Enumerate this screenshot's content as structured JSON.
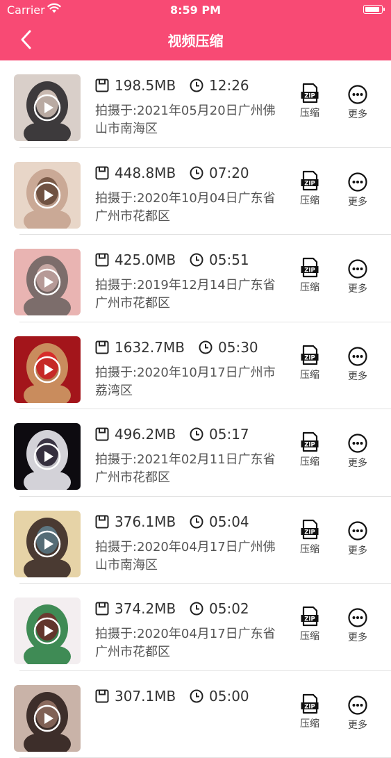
{
  "status_bar": {
    "carrier": "Carrier",
    "time": "8:59 PM",
    "battery_level": 1.0
  },
  "header": {
    "title": "视频压缩",
    "back_icon": "chevron-left-icon"
  },
  "colors": {
    "brand": "#f84a74",
    "separator": "#e2e2e2",
    "text": "#333333"
  },
  "actions": {
    "compress_label": "压缩",
    "more_label": "更多"
  },
  "videos": [
    {
      "size": "198.5MB",
      "duration": "12:26",
      "desc": "拍摄于:2021年05月20日广州佛山市南海区",
      "thumb_colors": [
        "#d9cfc9",
        "#c9b9b0",
        "#3d3a3c"
      ]
    },
    {
      "size": "448.8MB",
      "duration": "07:20",
      "desc": "拍摄于:2020年10月04日广东省广州市花都区",
      "thumb_colors": [
        "#e8d6c8",
        "#7a5a48",
        "#caa996"
      ]
    },
    {
      "size": "425.0MB",
      "duration": "05:51",
      "desc": "拍摄于:2019年12月14日广东省广州市花都区",
      "thumb_colors": [
        "#e9b4b2",
        "#c6a8a4",
        "#7c6d6b"
      ]
    },
    {
      "size": "1632.7MB",
      "duration": "05:30",
      "desc": "拍摄于:2020年10月17日广州市荔湾区",
      "thumb_colors": [
        "#a3151b",
        "#d72d2b",
        "#c98c5d"
      ]
    },
    {
      "size": "496.2MB",
      "duration": "05:17",
      "desc": "拍摄于:2021年02月11日广东省广州市花都区",
      "thumb_colors": [
        "#0d0b10",
        "#3a3444",
        "#d3d2d8"
      ]
    },
    {
      "size": "376.1MB",
      "duration": "05:04",
      "desc": "拍摄于:2020年04月17日广州佛山市南海区",
      "thumb_colors": [
        "#e6d3a7",
        "#5d7681",
        "#4a3a32"
      ]
    },
    {
      "size": "374.2MB",
      "duration": "05:02",
      "desc": "拍摄于:2020年04月17日广东省广州市花都区",
      "thumb_colors": [
        "#f3eef0",
        "#6b3a30",
        "#3f8b55"
      ]
    },
    {
      "size": "307.1MB",
      "duration": "05:00",
      "desc": "",
      "thumb_colors": [
        "#c9b3a8",
        "#8b6a5d",
        "#3d2e2a"
      ]
    }
  ]
}
